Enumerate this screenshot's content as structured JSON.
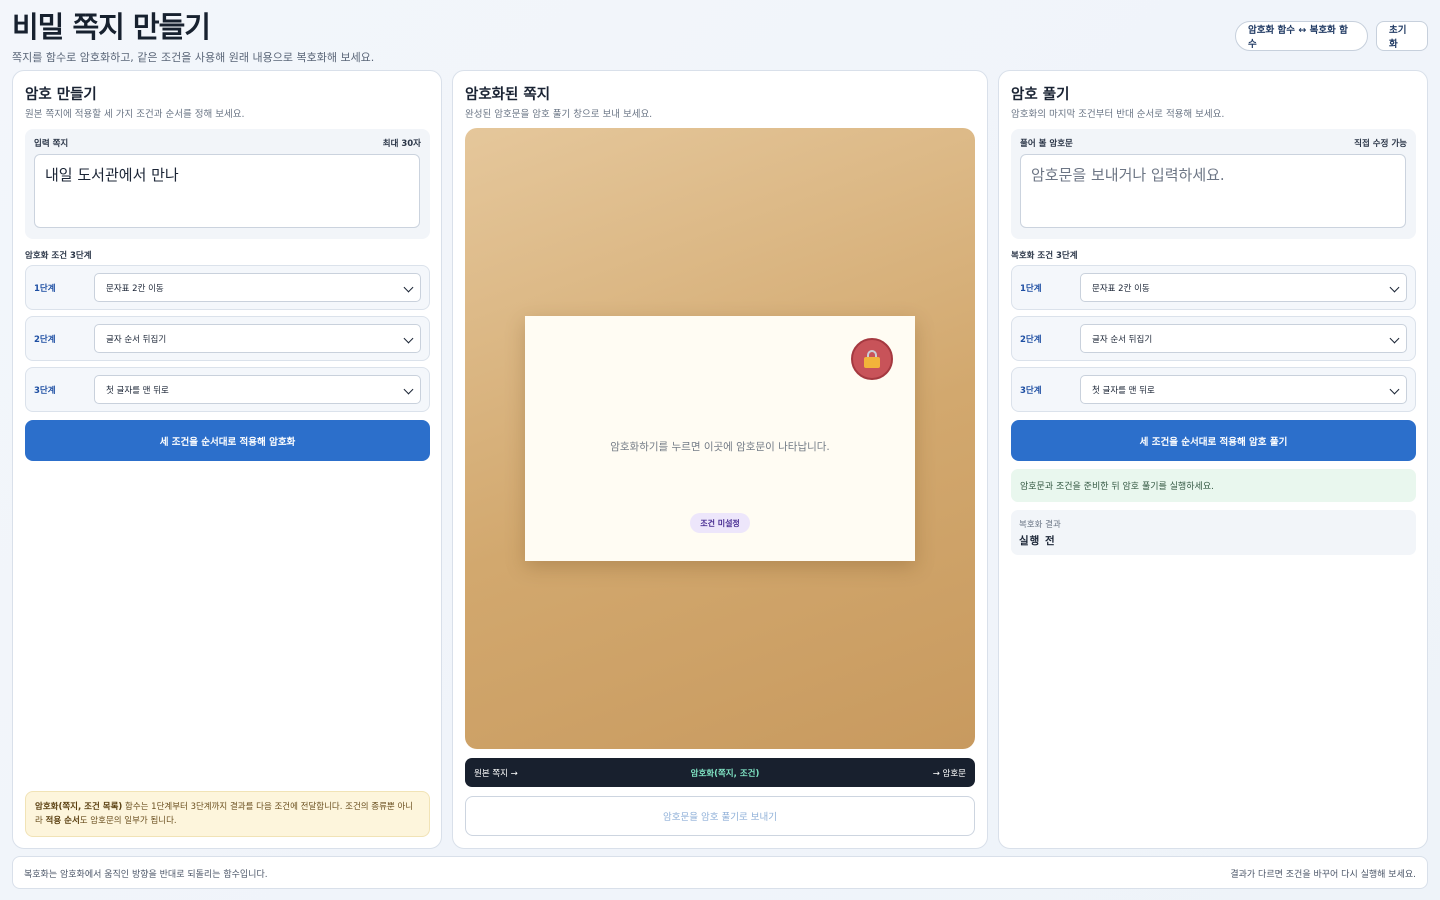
{
  "header": {
    "title": "비밀 쪽지 만들기",
    "subtitle": "쪽지를 함수로 암호화하고, 같은 조건을 사용해 원래 내용으로 복호화해 보세요.",
    "toggle_label": "암호화 함수 ↔ 복호화 함수",
    "reset_label": "초기화"
  },
  "encrypt_panel": {
    "title": "암호 만들기",
    "description": "원본 쪽지에 적용할 세 가지 조건과 순서를 정해 보세요.",
    "input_label": "입력 쪽지",
    "input_hint": "최대 30자",
    "input_value": "내일 도서관에서 만나",
    "steps_label": "암호화 조건 3단계",
    "steps": [
      {
        "label": "1단계",
        "value": "문자표 2칸 이동"
      },
      {
        "label": "2단계",
        "value": "글자 순서 뒤집기"
      },
      {
        "label": "3단계",
        "value": "첫 글자를 맨 뒤로"
      }
    ],
    "action_label": "세 조건을 순서대로 적용해 암호화",
    "note_bold1": "암호화(쪽지, 조건 목록)",
    "note_text1": " 함수는 1단계부터 3단계까지 결과를 다음 조건에 전달합니다. 조건의 종류뿐 아니라 ",
    "note_bold2": "적용 순서",
    "note_text2": "도 암호문의 일부가 됩니다."
  },
  "cipher_panel": {
    "title": "암호화된 쪽지",
    "description": "완성된 암호문을 암호 풀기 창으로 보내 보세요.",
    "card_text": "암호화하기를 누르면 이곳에 암호문이 나타납니다.",
    "badge": "조건 미설정",
    "flow_left": "원본 쪽지 →",
    "flow_mid": "암호화(쪽지, 조건)",
    "flow_right": "→ 암호문",
    "send_label": "암호문을 암호 풀기로 보내기",
    "seal_icon": "lock-icon"
  },
  "decrypt_panel": {
    "title": "암호 풀기",
    "description": "암호화의 마지막 조건부터 반대 순서로 적용해 보세요.",
    "input_label": "풀어 볼 암호문",
    "input_hint": "직접 수정 가능",
    "input_placeholder": "암호문을 보내거나 입력하세요.",
    "steps_label": "복호화 조건 3단계",
    "steps": [
      {
        "label": "1단계",
        "value": "문자표 2칸 이동"
      },
      {
        "label": "2단계",
        "value": "글자 순서 뒤집기"
      },
      {
        "label": "3단계",
        "value": "첫 글자를 맨 뒤로"
      }
    ],
    "action_label": "세 조건을 순서대로 적용해 암호 풀기",
    "status_msg": "암호문과 조건을 준비한 뒤 암호 풀기를 실행하세요.",
    "result_label": "복호화 결과",
    "result_value": "실행 전"
  },
  "footer": {
    "left": "복호화는 암호화에서 움직인 방향을 반대로 되돌리는 함수입니다.",
    "right": "결과가 다르면 조건을 바꾸어 다시 실행해 보세요."
  },
  "colors": {
    "primary": "#2c6fcb",
    "dark_bar": "#18202e",
    "seal": "#c85359",
    "accent_green": "#7fe3c3"
  }
}
